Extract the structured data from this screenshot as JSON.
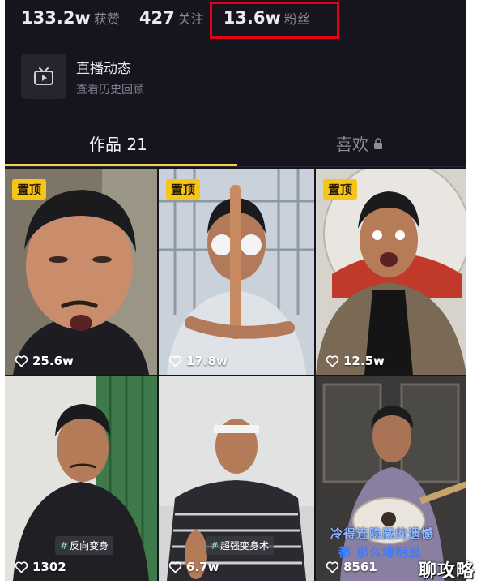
{
  "stats": {
    "likes_received": {
      "value": "133.2w",
      "label": "获赞"
    },
    "following": {
      "value": "427",
      "label": "关注"
    },
    "followers": {
      "value": "13.6w",
      "label": "粉丝"
    }
  },
  "live": {
    "title": "直播动态",
    "subtitle": "查看历史回顾"
  },
  "tabs": {
    "works": "作品 21",
    "likes": "喜欢"
  },
  "videos": [
    {
      "pinned": "置顶",
      "likes": "25.6w"
    },
    {
      "pinned": "置顶",
      "likes": "17.8w"
    },
    {
      "pinned": "置顶",
      "likes": "12.5w"
    },
    {
      "likes": "1302",
      "tag": "反向变身"
    },
    {
      "likes": "6.7w",
      "tag": "超强变身术"
    },
    {
      "likes": "8561",
      "caption_line1": "冷得连隐藏的遗憾",
      "caption_line2": "都 那么地明显"
    }
  ],
  "watermark": "聊攻略",
  "colors": {
    "background": "#15141f",
    "highlight_box": "#e60012",
    "tab_underline": "#f2d33b",
    "pin_badge": "#f5c518"
  }
}
